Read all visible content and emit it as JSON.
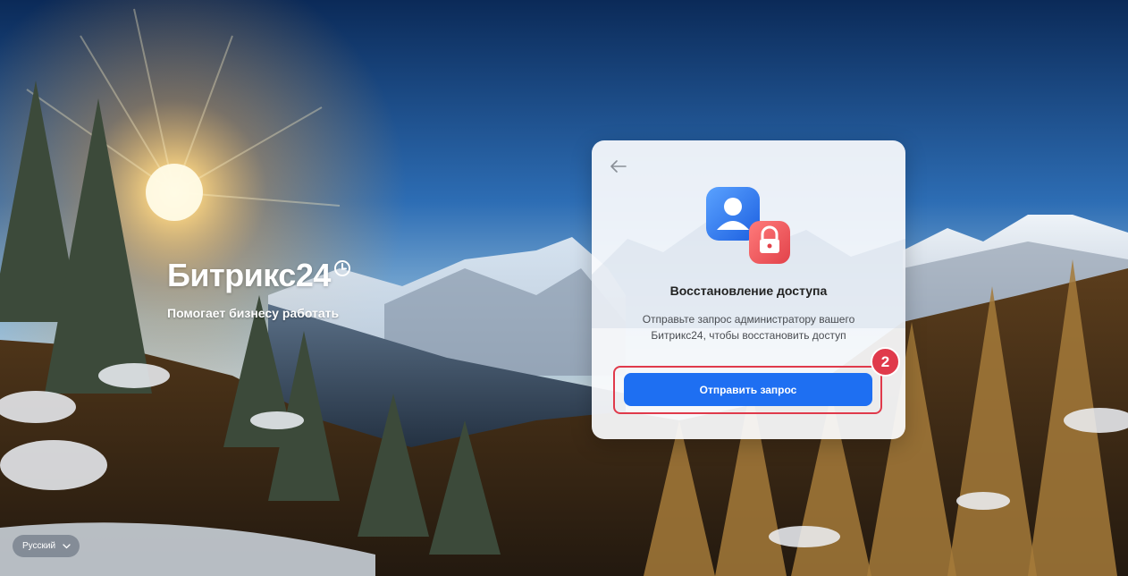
{
  "brand": {
    "name": "Битрикс24",
    "tagline": "Помогает бизнесу работать"
  },
  "card": {
    "back_icon": "arrow-left-icon",
    "hero_icon": "user-lock-icon",
    "title": "Восстановление доступа",
    "description": "Отправьте запрос администратору вашего Битрикс24, чтобы восстановить доступ",
    "submit_label": "Отправить запрос"
  },
  "annotation": {
    "step": "2",
    "color": "#e03a4b"
  },
  "language": {
    "selected": "Русский",
    "icon": "chevron-down-icon"
  },
  "colors": {
    "accent": "#1e6ff2",
    "sky_top": "#0b2a58",
    "sun": "#ffe7a8"
  }
}
